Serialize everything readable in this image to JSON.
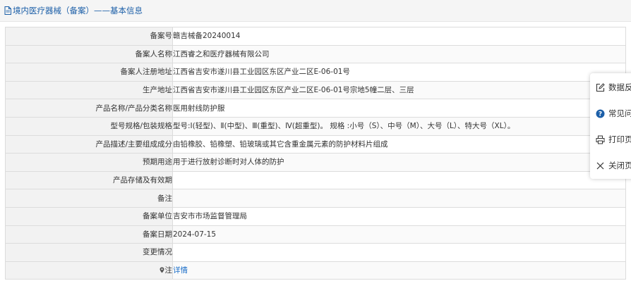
{
  "header": {
    "title": "境内医疗器械（备案）——基本信息"
  },
  "rows": [
    {
      "label": "备案号",
      "value": "赣吉械备20240014"
    },
    {
      "label": "备案人名称",
      "value": "江西睿之和医疗器械有限公司"
    },
    {
      "label": "备案人注册地址",
      "value": "江西省吉安市遂川县工业园区东区产业二区E-06-01号"
    },
    {
      "label": "生产地址",
      "value": "江西省吉安市遂川县工业园区东区产业二区E-06-01号宗地5幢二层、三层"
    },
    {
      "label": "产品名称/产品分类名称",
      "value": "医用射线防护服"
    },
    {
      "label": "型号规格/包装规格",
      "value": "型号:Ⅰ(轻型)、Ⅱ(中型)、Ⅲ(重型)、Ⅳ(超重型)。 规格 :小号（S）、中号（M）、大号（L）、特大号（XL）。"
    },
    {
      "label": "产品描述/主要组成成分",
      "value": "由铅橡胶、铅橡塑、铅玻璃或其它含重金属元素的防护材料片组成"
    },
    {
      "label": "预期用途",
      "value": "用于进行放射诊断时对人体的防护"
    },
    {
      "label": "产品存储及有效期",
      "value": ""
    },
    {
      "label": "备注",
      "value": ""
    },
    {
      "label": "备案单位",
      "value": "吉安市市场监督管理局"
    },
    {
      "label": "备案日期",
      "value": "2024-07-15"
    },
    {
      "label": "变更情况",
      "value": ""
    }
  ],
  "note_row": {
    "label": "注",
    "link": "详情"
  },
  "float_panel": {
    "items": [
      {
        "label": "数据反",
        "icon": "edit-icon"
      },
      {
        "label": "常见问",
        "icon": "question-icon"
      },
      {
        "label": "打印页",
        "icon": "printer-icon"
      },
      {
        "label": "关闭页",
        "icon": "close-icon"
      }
    ]
  },
  "colors": {
    "title": "#1c5fa8",
    "link": "#1c6fc9",
    "label_bg": "#f2f2f2",
    "border": "#dcdcdc"
  }
}
